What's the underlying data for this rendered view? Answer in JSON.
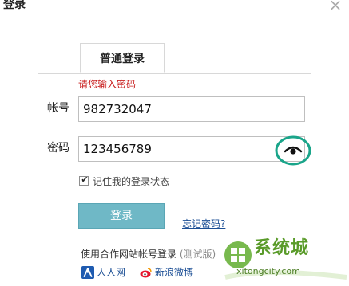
{
  "window": {
    "title": "登录",
    "close_icon": "close-icon"
  },
  "tabs": [
    {
      "label": "普通登录",
      "active": true
    }
  ],
  "form": {
    "error_message": "请您输入密码",
    "error_color": "#c81e1e",
    "account_label": "帐号",
    "account_value": "982732047",
    "password_label": "密码",
    "password_value": "123456789",
    "show_password_icon": "eye-icon",
    "highlight_color": "#1aa58a",
    "remember_label": "记住我的登录状态",
    "remember_checked": true,
    "login_button": "登录",
    "login_button_color": "#6fb8c6",
    "forgot_link": "忘记密码?"
  },
  "partner_login": {
    "title": "使用合作网站帐号登录",
    "beta": "(测试版)",
    "providers": [
      {
        "name": "人人网",
        "icon": "renren-icon"
      },
      {
        "name": "新浪微博",
        "icon": "weibo-icon"
      }
    ]
  },
  "watermark": {
    "text": "系统城",
    "url": "xitongcity.com"
  }
}
